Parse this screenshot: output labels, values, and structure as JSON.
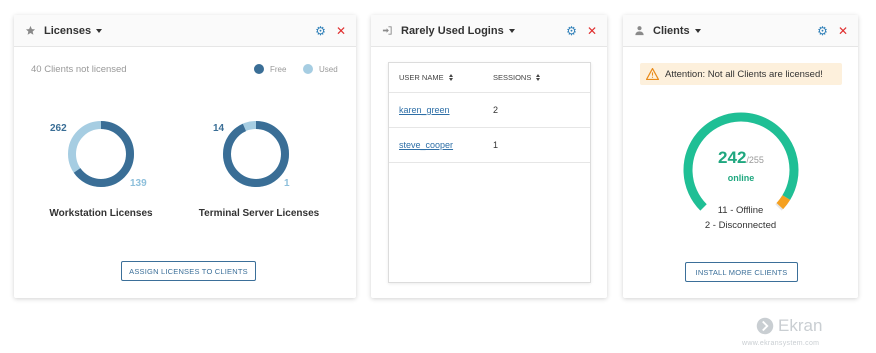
{
  "licenses": {
    "title": "Licenses",
    "status_text": "40 Clients not licensed",
    "legend": [
      {
        "label": "Free",
        "color": "#3a6e96"
      },
      {
        "label": "Used",
        "color": "#a6cde2"
      }
    ],
    "workstation": {
      "label": "Workstation Licenses",
      "free": "262",
      "used": "139",
      "free_fraction": 0.653
    },
    "terminal": {
      "label": "Terminal Server Licenses",
      "free": "14",
      "used": "1",
      "free_fraction": 0.933
    },
    "button": "ASSIGN LICENSES TO CLIENTS"
  },
  "logins": {
    "title": "Rarely Used Logins",
    "columns": [
      "USER NAME",
      "SESSIONS"
    ],
    "rows": [
      {
        "user": "karen_green",
        "sessions": "2"
      },
      {
        "user": "steve_cooper",
        "sessions": "1"
      }
    ]
  },
  "clients": {
    "title": "Clients",
    "alert": "Attention: Not all Clients are licensed!",
    "online_count": "242",
    "total": "/255",
    "online_label": "online",
    "offline": "11 - Offline",
    "disconnected": "2 - Disconnected",
    "online_fraction": 0.949,
    "offline_fraction": 0.043,
    "button": "INSTALL MORE CLIENTS",
    "colors": {
      "online": "#1fbf95",
      "offline": "#f5a020",
      "disconnected": "#cccccc"
    }
  },
  "branding": {
    "name": "Ekran",
    "url": "www.ekransystem.com"
  }
}
